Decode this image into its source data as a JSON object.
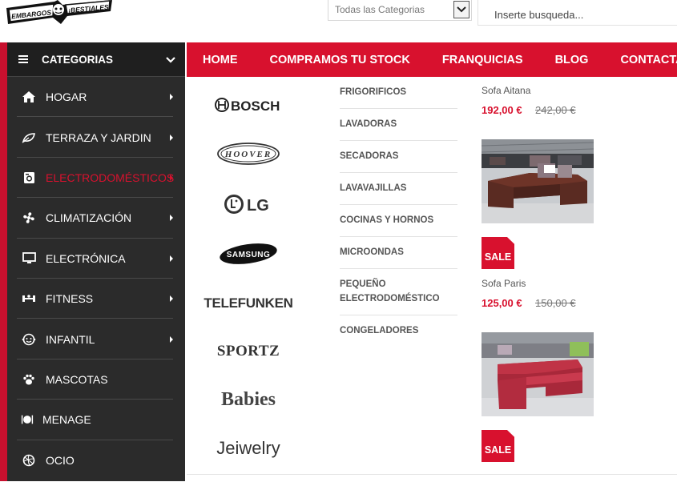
{
  "header": {
    "logo_text": "EMBARGOS ¡BESTIALES!",
    "category_select": "Todas las Categorias",
    "search_placeholder": "Inserte busqueda..."
  },
  "sidebar": {
    "title": "CATEGORIAS",
    "items": [
      {
        "label": "HOGAR",
        "icon": "home-icon",
        "has_submenu": true
      },
      {
        "label": "TERRAZA Y JARDIN",
        "icon": "leaf-icon",
        "has_submenu": true
      },
      {
        "label": "ELECTRODOMÉSTICOS",
        "icon": "washing-machine-icon",
        "has_submenu": true,
        "active": true
      },
      {
        "label": "CLIMATIZACIÓN",
        "icon": "fan-icon",
        "has_submenu": true
      },
      {
        "label": "ELECTRÓNICA",
        "icon": "monitor-icon",
        "has_submenu": true
      },
      {
        "label": "FITNESS",
        "icon": "dumbbell-icon",
        "has_submenu": true
      },
      {
        "label": "INFANTIL",
        "icon": "baby-icon",
        "has_submenu": true
      },
      {
        "label": "MASCOTAS",
        "icon": "paw-icon",
        "has_submenu": false
      },
      {
        "label": "MENAGE",
        "icon": "dining-icon",
        "has_submenu": false
      },
      {
        "label": "OCIO",
        "icon": "ball-icon",
        "has_submenu": false
      }
    ]
  },
  "nav": {
    "items": [
      "HOME",
      "COMPRAMOS TU STOCK",
      "FRANQUICIAS",
      "BLOG",
      "CONTACTA"
    ]
  },
  "mega": {
    "brands": [
      "BOSCH",
      "HOOVER",
      "LG",
      "SAMSUNG",
      "TELEFUNKEN",
      "SPORTZ",
      "Babies",
      "Jeiwelry"
    ],
    "subcategories": [
      "FRIGORIFICOS",
      "LAVADORAS",
      "SECADORAS",
      "LAVAVAJILLAS",
      "COCINAS Y HORNOS",
      "MICROONDAS",
      "PEQUEÑO ELECTRODOMÉSTICO",
      "CONGELADORES"
    ],
    "products": [
      {
        "name": "Sofa Aitana",
        "price": "192,00 €",
        "old_price": "242,00 €",
        "badge": "SALE",
        "image": "brown-sofa"
      },
      {
        "name": "Sofa Paris",
        "price": "125,00 €",
        "old_price": "150,00 €",
        "badge": "SALE",
        "image": "red-sofa"
      }
    ]
  },
  "colors": {
    "accent_red": "#d8112e",
    "sidebar_dark": "#2b2b2b",
    "sidebar_head": "#1f1f1f"
  }
}
